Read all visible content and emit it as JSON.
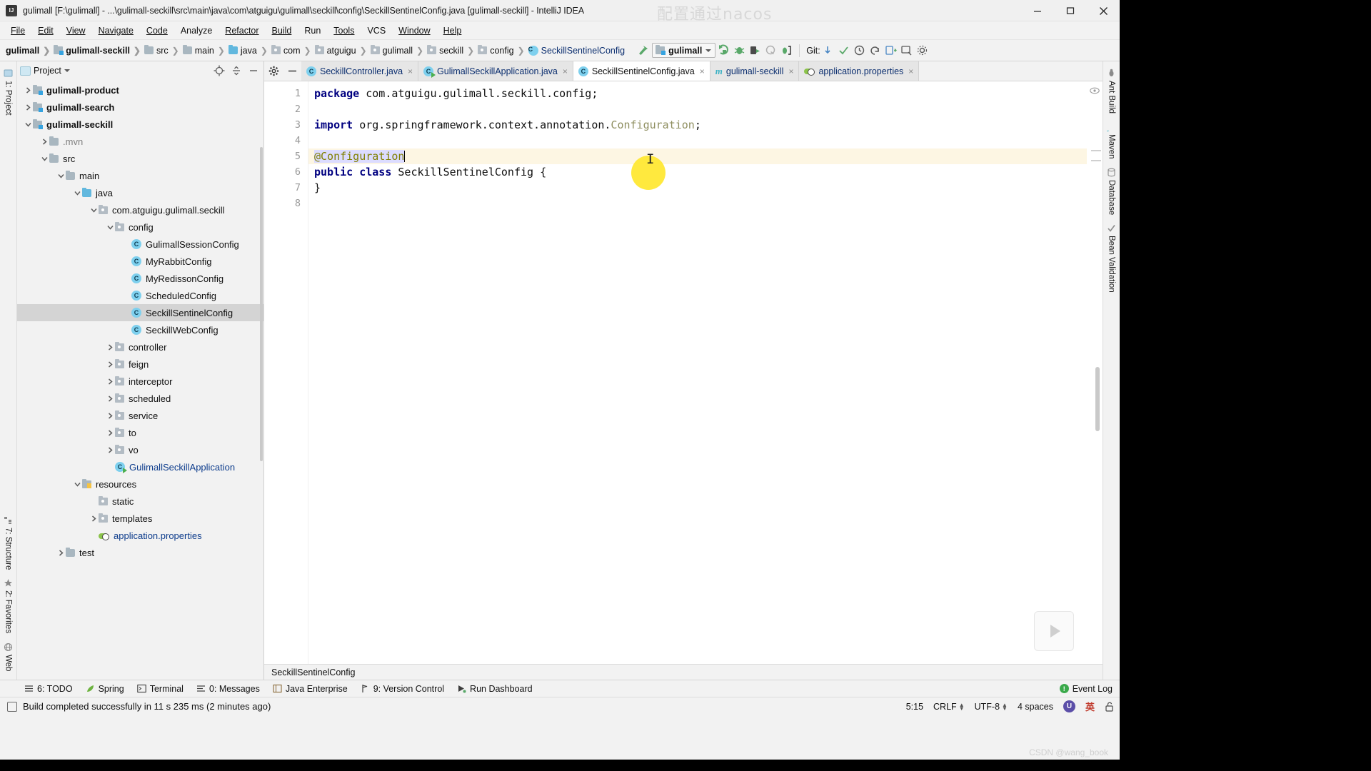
{
  "window": {
    "title": "gulimall [F:\\gulimall] - ...\\gulimall-seckill\\src\\main\\java\\com\\atguigu\\gulimall\\seckill\\config\\SeckillSentinelConfig.java [gulimall-seckill] - IntelliJ IDEA",
    "app_icon": "intellij-idea-icon",
    "minimize": "—",
    "maximize": "☐",
    "close": "✕"
  },
  "watermarks": {
    "top": "配置通过nacos",
    "bottom": "CSDN @wang_book"
  },
  "menubar": [
    {
      "label": "File",
      "mnemonic": "F"
    },
    {
      "label": "Edit",
      "mnemonic": "E"
    },
    {
      "label": "View",
      "mnemonic": "V"
    },
    {
      "label": "Navigate",
      "mnemonic": "N"
    },
    {
      "label": "Code",
      "mnemonic": "C"
    },
    {
      "label": "Analyze",
      "mnemonic": "z"
    },
    {
      "label": "Refactor",
      "mnemonic": "R"
    },
    {
      "label": "Build",
      "mnemonic": "B"
    },
    {
      "label": "Run",
      "mnemonic": "u"
    },
    {
      "label": "Tools",
      "mnemonic": "T"
    },
    {
      "label": "VCS",
      "mnemonic": "S"
    },
    {
      "label": "Window",
      "mnemonic": "W"
    },
    {
      "label": "Help",
      "mnemonic": "H"
    }
  ],
  "breadcrumbs": [
    {
      "label": "gulimall",
      "icon": "none",
      "bold": true
    },
    {
      "label": "gulimall-seckill",
      "icon": "module-icon",
      "bold": true
    },
    {
      "label": "src",
      "icon": "folder-icon",
      "bold": false
    },
    {
      "label": "main",
      "icon": "folder-icon",
      "bold": false
    },
    {
      "label": "java",
      "icon": "source-folder-icon",
      "bold": false
    },
    {
      "label": "com",
      "icon": "package-icon",
      "bold": false
    },
    {
      "label": "atguigu",
      "icon": "package-icon",
      "bold": false
    },
    {
      "label": "gulimall",
      "icon": "package-icon",
      "bold": false
    },
    {
      "label": "seckill",
      "icon": "package-icon",
      "bold": false
    },
    {
      "label": "config",
      "icon": "package-icon",
      "bold": false
    },
    {
      "label": "SeckillSentinelConfig",
      "icon": "java-class-icon",
      "bold": false
    }
  ],
  "toolbar": {
    "build_icon": "hammer-icon",
    "run_config": {
      "name": "gulimall",
      "icon": "module-run-icon",
      "dropdown": "chevron-down-icon"
    },
    "actions": [
      {
        "name": "run-icon"
      },
      {
        "name": "debug-icon"
      },
      {
        "name": "run-with-coverage-icon"
      },
      {
        "name": "profile-icon"
      },
      {
        "name": "attach-debugger-icon"
      }
    ],
    "git_label": "Git:",
    "git_actions": [
      {
        "name": "update-project-icon"
      },
      {
        "name": "commit-icon"
      },
      {
        "name": "history-icon"
      },
      {
        "name": "rollback-icon"
      },
      {
        "name": "push-icon"
      },
      {
        "name": "search-everywhere-icon"
      },
      {
        "name": "settings-icon"
      }
    ]
  },
  "left_rail": [
    {
      "label": "1: Project",
      "icon": "project-icon"
    },
    {
      "label": "7: Structure",
      "icon": "structure-icon"
    },
    {
      "label": "2: Favorites",
      "icon": "favorites-icon"
    },
    {
      "label": "Web",
      "icon": "web-icon"
    }
  ],
  "right_rail": [
    {
      "label": "Ant Build",
      "icon": "ant-icon"
    },
    {
      "label": "Maven",
      "icon": "maven-icon"
    },
    {
      "label": "Database",
      "icon": "database-icon"
    },
    {
      "label": "Bean Validation",
      "icon": "bean-validation-icon"
    }
  ],
  "project_panel": {
    "title": "Project",
    "dropdown": "chevron-down-icon",
    "locate_icon": "locate-file-icon",
    "collapse_icon": "collapse-all-icon",
    "hide_icon": "hide-panel-icon",
    "tree": [
      {
        "label": "gulimall-product",
        "depth": 0,
        "arrow": "right",
        "icon": "module-icon",
        "style": "bold",
        "selected": false
      },
      {
        "label": "gulimall-search",
        "depth": 0,
        "arrow": "right",
        "icon": "module-icon",
        "style": "bold",
        "selected": false
      },
      {
        "label": "gulimall-seckill",
        "depth": 0,
        "arrow": "down",
        "icon": "module-icon",
        "style": "bold",
        "selected": false
      },
      {
        "label": ".mvn",
        "depth": 1,
        "arrow": "right",
        "icon": "folder-icon",
        "style": "dim",
        "selected": false
      },
      {
        "label": "src",
        "depth": 1,
        "arrow": "down",
        "icon": "folder-icon",
        "style": "normal",
        "selected": false
      },
      {
        "label": "main",
        "depth": 2,
        "arrow": "down",
        "icon": "folder-icon",
        "style": "normal",
        "selected": false
      },
      {
        "label": "java",
        "depth": 3,
        "arrow": "down",
        "icon": "source-folder-icon",
        "style": "normal",
        "selected": false
      },
      {
        "label": "com.atguigu.gulimall.seckill",
        "depth": 4,
        "arrow": "down",
        "icon": "package-icon",
        "style": "normal",
        "selected": false
      },
      {
        "label": "config",
        "depth": 5,
        "arrow": "down",
        "icon": "package-icon",
        "style": "normal",
        "selected": false
      },
      {
        "label": "GulimallSessionConfig",
        "depth": 6,
        "arrow": "none",
        "icon": "java-class-icon",
        "style": "normal",
        "selected": false
      },
      {
        "label": "MyRabbitConfig",
        "depth": 6,
        "arrow": "none",
        "icon": "java-class-icon",
        "style": "normal",
        "selected": false
      },
      {
        "label": "MyRedissonConfig",
        "depth": 6,
        "arrow": "none",
        "icon": "java-class-icon",
        "style": "normal",
        "selected": false
      },
      {
        "label": "ScheduledConfig",
        "depth": 6,
        "arrow": "none",
        "icon": "java-class-icon",
        "style": "normal",
        "selected": false
      },
      {
        "label": "SeckillSentinelConfig",
        "depth": 6,
        "arrow": "none",
        "icon": "java-class-icon",
        "style": "normal",
        "selected": true
      },
      {
        "label": "SeckillWebConfig",
        "depth": 6,
        "arrow": "none",
        "icon": "java-class-icon",
        "style": "normal",
        "selected": false
      },
      {
        "label": "controller",
        "depth": 5,
        "arrow": "right",
        "icon": "package-icon",
        "style": "normal",
        "selected": false
      },
      {
        "label": "feign",
        "depth": 5,
        "arrow": "right",
        "icon": "package-icon",
        "style": "normal",
        "selected": false
      },
      {
        "label": "interceptor",
        "depth": 5,
        "arrow": "right",
        "icon": "package-icon",
        "style": "normal",
        "selected": false
      },
      {
        "label": "scheduled",
        "depth": 5,
        "arrow": "right",
        "icon": "package-icon",
        "style": "normal",
        "selected": false
      },
      {
        "label": "service",
        "depth": 5,
        "arrow": "right",
        "icon": "package-icon",
        "style": "normal",
        "selected": false
      },
      {
        "label": "to",
        "depth": 5,
        "arrow": "right",
        "icon": "package-icon",
        "style": "normal",
        "selected": false
      },
      {
        "label": "vo",
        "depth": 5,
        "arrow": "right",
        "icon": "package-icon",
        "style": "normal",
        "selected": false
      },
      {
        "label": "GulimallSeckillApplication",
        "depth": 5,
        "arrow": "none",
        "icon": "java-class-run-icon",
        "style": "blue",
        "selected": false
      },
      {
        "label": "resources",
        "depth": 3,
        "arrow": "down",
        "icon": "resources-folder-icon",
        "style": "normal",
        "selected": false
      },
      {
        "label": "static",
        "depth": 4,
        "arrow": "none",
        "icon": "package-icon",
        "style": "normal",
        "selected": false
      },
      {
        "label": "templates",
        "depth": 4,
        "arrow": "right",
        "icon": "package-icon",
        "style": "normal",
        "selected": false
      },
      {
        "label": "application.properties",
        "depth": 4,
        "arrow": "none",
        "icon": "properties-icon",
        "style": "blue",
        "selected": false
      },
      {
        "label": "test",
        "depth": 2,
        "arrow": "right",
        "icon": "folder-icon",
        "style": "normal",
        "selected": false
      }
    ]
  },
  "editor": {
    "settings_icon": "gear-icon",
    "hide_icon": "hide-editor-icon",
    "tabs": [
      {
        "label": "SeckillController.java",
        "icon": "java-class-icon",
        "active": false,
        "close": "×"
      },
      {
        "label": "GulimallSeckillApplication.java",
        "icon": "java-class-run-icon",
        "active": false,
        "close": "×"
      },
      {
        "label": "SeckillSentinelConfig.java",
        "icon": "java-class-icon",
        "active": true,
        "close": "×"
      },
      {
        "label": "gulimall-seckill",
        "icon": "maven-pom-icon",
        "active": false,
        "close": "×"
      },
      {
        "label": "application.properties",
        "icon": "properties-icon",
        "active": false,
        "close": "×"
      }
    ],
    "line_numbers": [
      "1",
      "2",
      "3",
      "4",
      "5",
      "6",
      "7",
      "8"
    ],
    "code": {
      "l1_kw": "package",
      "l1_rest": " com.atguigu.gulimall.seckill.config;",
      "l3_kw": "import",
      "l3_mid": " org.springframework.context.annotation.",
      "l3_type": "Configuration",
      "l3_end": ";",
      "l5_anno": "@Configuration",
      "l6_kw1": "public",
      "l6_kw2": "class",
      "l6_name": " SeckillSentinelConfig {",
      "l7": "}"
    },
    "breadcrumb_bottom": "SeckillSentinelConfig",
    "eye_icon": "preview-eye-icon",
    "play_overlay_icon": "play-icon"
  },
  "bottom_tool_buttons": [
    {
      "label": "6: TODO",
      "mnemonic": "6",
      "icon": "todo-icon"
    },
    {
      "label": "Spring",
      "mnemonic": "",
      "icon": "spring-leaf-icon"
    },
    {
      "label": "Terminal",
      "mnemonic": "",
      "icon": "terminal-icon"
    },
    {
      "label": "0: Messages",
      "mnemonic": "0",
      "icon": "messages-icon"
    },
    {
      "label": "Java Enterprise",
      "mnemonic": "",
      "icon": "java-enterprise-icon"
    },
    {
      "label": "9: Version Control",
      "mnemonic": "9",
      "icon": "version-control-icon"
    },
    {
      "label": "Run Dashboard",
      "mnemonic": "",
      "icon": "run-dashboard-icon"
    }
  ],
  "event_log": {
    "label": "Event Log",
    "icon": "event-log-icon"
  },
  "status_bar": {
    "icon": "build-status-icon",
    "message": "Build completed successfully in 11 s 235 ms (2 minutes ago)",
    "caret_position": "5:15",
    "line_separator": "CRLF",
    "encoding": "UTF-8",
    "indent": "4 spaces",
    "ime_badge": "U",
    "ime_label": "英",
    "lock_icon": "unlocked-icon"
  },
  "colors": {
    "accent_blue": "#35a3e0",
    "keyword": "#000080",
    "annotation": "#808000",
    "highlight_line": "#fdf6e3",
    "cursor_blob": "#ffe72e",
    "selection": "#d4d4d4"
  }
}
